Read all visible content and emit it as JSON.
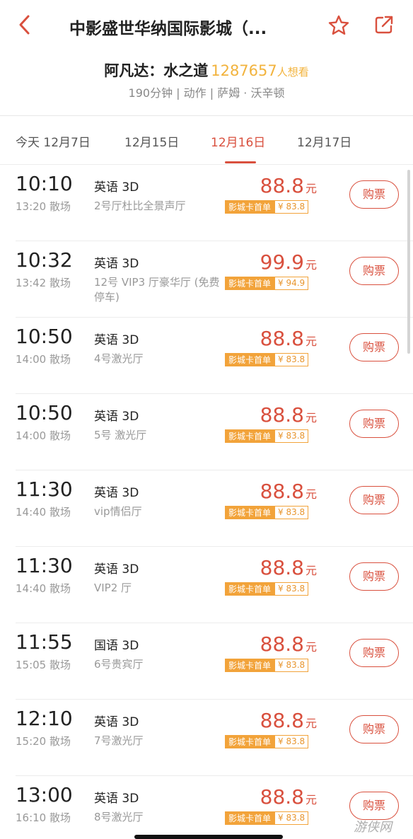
{
  "header": {
    "title": "中影盛世华纳国际影城（...",
    "back_icon": "back-arrow-icon",
    "star_icon": "star-outline-icon",
    "share_icon": "share-icon",
    "accent_color": "#d9503e"
  },
  "movie": {
    "name": "阿凡达：水之道",
    "want_count": "1287657",
    "want_label": "人想看",
    "meta": "190分钟 | 动作 | 萨姆 · 沃辛顿"
  },
  "dates": [
    {
      "label": "今天 12月7日",
      "active": false
    },
    {
      "label": "12月15日",
      "active": false
    },
    {
      "label": "12月16日",
      "active": true
    },
    {
      "label": "12月17日",
      "active": false
    }
  ],
  "showtimes": [
    {
      "start": "10:10",
      "end": "13:20 散场",
      "lang": "英语 3D",
      "hall": "2号厅杜比全景声厅",
      "price": "88.8",
      "yuan": "元",
      "promo_tag": "影城卡首单",
      "promo_price": "¥ 83.8",
      "buy": "购票"
    },
    {
      "start": "10:32",
      "end": "13:42 散场",
      "lang": "英语 3D",
      "hall": "12号 VIP3 厅豪华厅 (免费停车)",
      "price": "99.9",
      "yuan": "元",
      "promo_tag": "影城卡首单",
      "promo_price": "¥ 94.9",
      "buy": "购票"
    },
    {
      "start": "10:50",
      "end": "14:00 散场",
      "lang": "英语 3D",
      "hall": "4号激光厅",
      "price": "88.8",
      "yuan": "元",
      "promo_tag": "影城卡首单",
      "promo_price": "¥ 83.8",
      "buy": "购票"
    },
    {
      "start": "10:50",
      "end": "14:00 散场",
      "lang": "英语 3D",
      "hall": "5号 激光厅",
      "price": "88.8",
      "yuan": "元",
      "promo_tag": "影城卡首单",
      "promo_price": "¥ 83.8",
      "buy": "购票"
    },
    {
      "start": "11:30",
      "end": "14:40 散场",
      "lang": "英语 3D",
      "hall": "vip情侣厅",
      "price": "88.8",
      "yuan": "元",
      "promo_tag": "影城卡首单",
      "promo_price": "¥ 83.8",
      "buy": "购票"
    },
    {
      "start": "11:30",
      "end": "14:40 散场",
      "lang": "英语 3D",
      "hall": "VIP2 厅",
      "price": "88.8",
      "yuan": "元",
      "promo_tag": "影城卡首单",
      "promo_price": "¥ 83.8",
      "buy": "购票"
    },
    {
      "start": "11:55",
      "end": "15:05 散场",
      "lang": "国语 3D",
      "hall": "6号贵宾厅",
      "price": "88.8",
      "yuan": "元",
      "promo_tag": "影城卡首单",
      "promo_price": "¥ 83.8",
      "buy": "购票"
    },
    {
      "start": "12:10",
      "end": "15:20 散场",
      "lang": "英语 3D",
      "hall": "7号激光厅",
      "price": "88.8",
      "yuan": "元",
      "promo_tag": "影城卡首单",
      "promo_price": "¥ 83.8",
      "buy": "购票"
    },
    {
      "start": "13:00",
      "end": "16:10 散场",
      "lang": "英语 3D",
      "hall": "8号激光厅",
      "price": "88.8",
      "yuan": "元",
      "promo_tag": "影城卡首单",
      "promo_price": "¥ 83.8",
      "buy": "购票"
    }
  ],
  "watermark": "游侠网"
}
